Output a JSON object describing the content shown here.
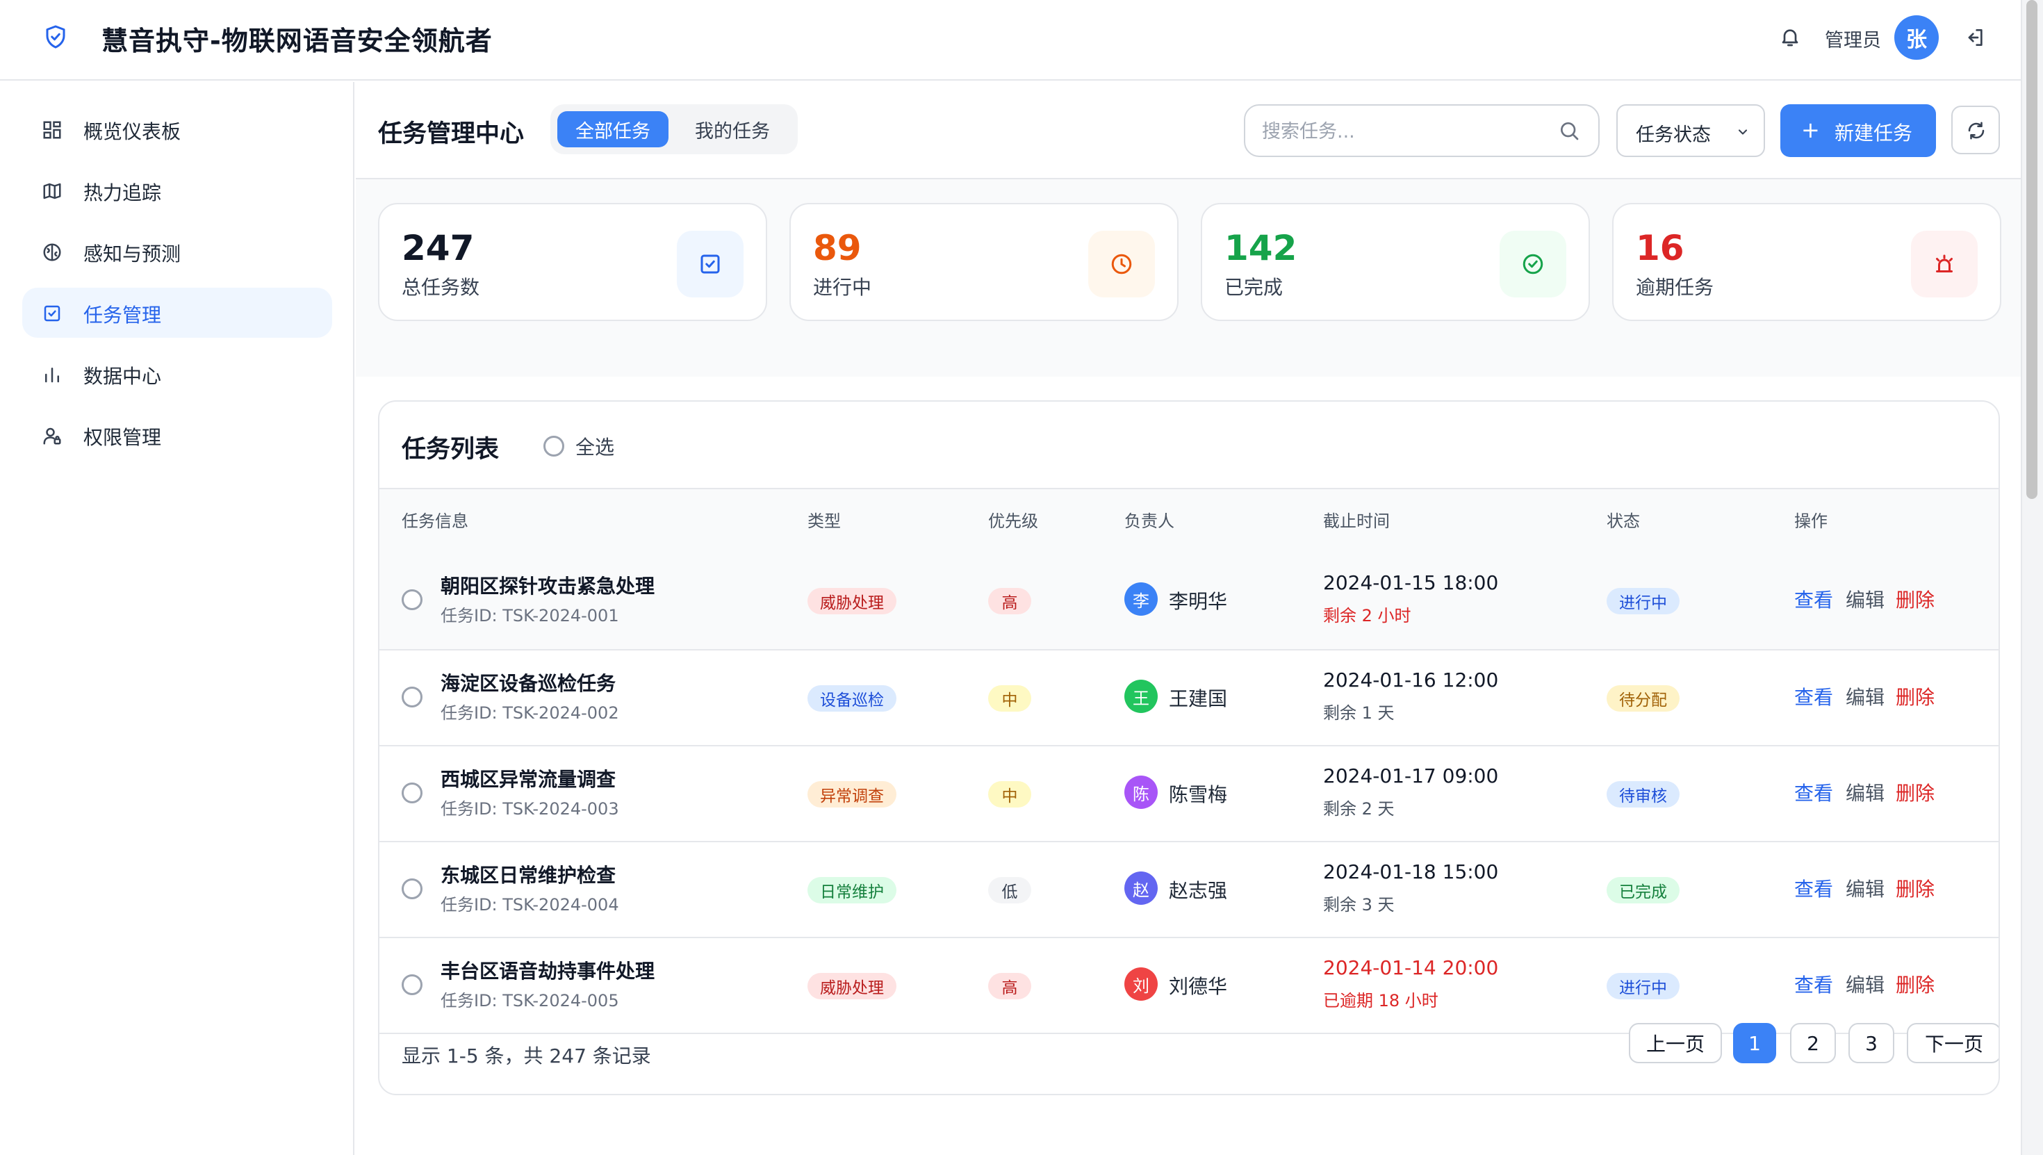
{
  "header": {
    "app_title": "慧音执守-物联网语音安全领航者",
    "user_role": "管理员",
    "user_avatar": "张",
    "icons": [
      "shield-check-icon",
      "bell-icon",
      "logout-icon"
    ]
  },
  "sidebar": {
    "items": [
      {
        "label": "概览仪表板",
        "icon": "dashboard-icon",
        "active": false
      },
      {
        "label": "热力追踪",
        "icon": "map-icon",
        "active": false
      },
      {
        "label": "感知与预测",
        "icon": "brain-icon",
        "active": false
      },
      {
        "label": "任务管理",
        "icon": "task-check-icon",
        "active": true
      },
      {
        "label": "数据中心",
        "icon": "bar-chart-icon",
        "active": false
      },
      {
        "label": "权限管理",
        "icon": "user-lock-icon",
        "active": false
      }
    ]
  },
  "toolbar": {
    "title": "任务管理中心",
    "tabs": [
      {
        "label": "全部任务",
        "active": true
      },
      {
        "label": "我的任务",
        "active": false
      }
    ],
    "search_placeholder": "搜索任务...",
    "status_filter": "任务状态",
    "new_task_label": "新建任务"
  },
  "stats": [
    {
      "value": "247",
      "label": "总任务数",
      "color": "#111827",
      "icon": "checkbox-icon",
      "icon_color": "#2563eb",
      "icon_bg": "#eff6ff"
    },
    {
      "value": "89",
      "label": "进行中",
      "color": "#ea580c",
      "icon": "clock-icon",
      "icon_color": "#ea580c",
      "icon_bg": "#fff7ed"
    },
    {
      "value": "142",
      "label": "已完成",
      "color": "#16a34a",
      "icon": "check-circle-icon",
      "icon_color": "#16a34a",
      "icon_bg": "#f0fdf4"
    },
    {
      "value": "16",
      "label": "逾期任务",
      "color": "#dc2626",
      "icon": "alarm-icon",
      "icon_color": "#dc2626",
      "icon_bg": "#fef2f2"
    }
  ],
  "task_list": {
    "title": "任务列表",
    "select_all": "全选",
    "columns": [
      "任务信息",
      "类型",
      "优先级",
      "负责人",
      "截止时间",
      "状态",
      "操作"
    ],
    "rows": [
      {
        "name": "朝阳区探针攻击紧急处理",
        "id": "任务ID: TSK-2024-001",
        "type": "威胁处理",
        "priority": "高",
        "owner": "李明华",
        "owner_initial": "李",
        "due": "2024-01-15 18:00",
        "due_note": "剩余 2 小时",
        "status": "进行中"
      },
      {
        "name": "海淀区设备巡检任务",
        "id": "任务ID: TSK-2024-002",
        "type": "设备巡检",
        "priority": "中",
        "owner": "王建国",
        "owner_initial": "王",
        "due": "2024-01-16 12:00",
        "due_note": "剩余 1 天",
        "status": "待分配"
      },
      {
        "name": "西城区异常流量调查",
        "id": "任务ID: TSK-2024-003",
        "type": "异常调查",
        "priority": "中",
        "owner": "陈雪梅",
        "owner_initial": "陈",
        "due": "2024-01-17 09:00",
        "due_note": "剩余 2 天",
        "status": "待审核"
      },
      {
        "name": "东城区日常维护检查",
        "id": "任务ID: TSK-2024-004",
        "type": "日常维护",
        "priority": "低",
        "owner": "赵志强",
        "owner_initial": "赵",
        "due": "2024-01-18 15:00",
        "due_note": "剩余 3 天",
        "status": "已完成"
      },
      {
        "name": "丰台区语音劫持事件处理",
        "id": "任务ID: TSK-2024-005",
        "type": "威胁处理",
        "priority": "高",
        "owner": "刘德华",
        "owner_initial": "刘",
        "due": "2024-01-14 20:00",
        "due_note": "已逾期 18 小时",
        "status": "进行中"
      }
    ],
    "actions": {
      "view": "查看",
      "edit": "编辑",
      "delete": "删除"
    }
  },
  "pagination": {
    "summary": "显示 1-5 条，共 247 条记录",
    "prev": "上一页",
    "pages": [
      "1",
      "2",
      "3"
    ],
    "current": "1",
    "next": "下一页"
  },
  "colors": {
    "accent": "#3b82f6",
    "danger": "#dc2626",
    "warning": "#ea580c",
    "success": "#16a34a"
  }
}
